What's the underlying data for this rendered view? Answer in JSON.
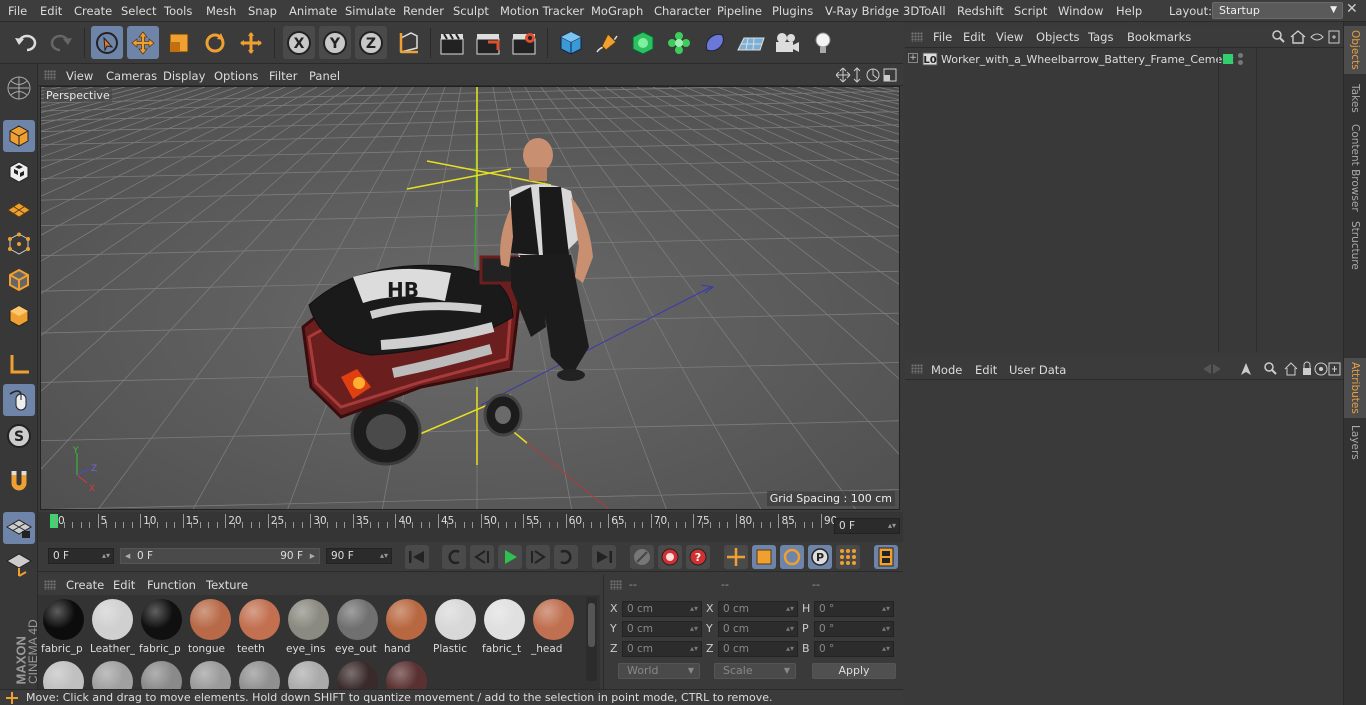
{
  "menu": [
    "File",
    "Edit",
    "Create",
    "Select",
    "Tools",
    "Mesh",
    "Snap",
    "Animate",
    "Simulate",
    "Render",
    "Sculpt",
    "Motion Tracker",
    "MoGraph",
    "Character",
    "Pipeline",
    "Plugins",
    "V-Ray Bridge",
    "3DToAll",
    "Redshift",
    "Script",
    "Window",
    "Help"
  ],
  "layout": {
    "label": "Layout:",
    "value": "Startup"
  },
  "viewport": {
    "menu": [
      "View",
      "Cameras",
      "Display",
      "Options",
      "Filter",
      "Panel"
    ],
    "camera_label": "Perspective",
    "grid_spacing": "Grid Spacing : 100 cm"
  },
  "timeline": {
    "ticks": [
      "0",
      "5",
      "10",
      "15",
      "20",
      "25",
      "30",
      "35",
      "40",
      "45",
      "50",
      "55",
      "60",
      "65",
      "70",
      "75",
      "80",
      "85",
      "90"
    ],
    "current_frame": "0 F",
    "start_field": "0 F",
    "range_start": "0 F",
    "range_end": "90 F",
    "end_field": "90 F"
  },
  "materials": {
    "menu": [
      "Create",
      "Edit",
      "Function",
      "Texture"
    ],
    "items": [
      {
        "name": "fabric_p",
        "color": "#0c0c0c"
      },
      {
        "name": "Leather_",
        "color": "#d0d0d0"
      },
      {
        "name": "fabric_p",
        "color": "#101010"
      },
      {
        "name": "tongue",
        "color": "#b86a48"
      },
      {
        "name": "teeth",
        "color": "#c27050"
      },
      {
        "name": "eye_ins",
        "color": "#8a8a80"
      },
      {
        "name": "eye_out",
        "color": "#707070"
      },
      {
        "name": "hand",
        "color": "#b86840"
      },
      {
        "name": "Plastic",
        "color": "#d8d8d8"
      },
      {
        "name": "fabric_t",
        "color": "#e0e0e0"
      },
      {
        "name": "_head",
        "color": "#c07050"
      }
    ]
  },
  "coords": {
    "headers": [
      "--",
      "--",
      "--"
    ],
    "rows": [
      {
        "l1": "X",
        "v1": "0 cm",
        "l2": "X",
        "v2": "0 cm",
        "l3": "H",
        "v3": "0 °"
      },
      {
        "l1": "Y",
        "v1": "0 cm",
        "l2": "Y",
        "v2": "0 cm",
        "l3": "P",
        "v3": "0 °"
      },
      {
        "l1": "Z",
        "v1": "0 cm",
        "l2": "Z",
        "v2": "0 cm",
        "l3": "B",
        "v3": "0 °"
      }
    ],
    "mode": "World",
    "scale": "Scale",
    "apply": "Apply"
  },
  "objects": {
    "menu": [
      "File",
      "Edit",
      "View",
      "Objects",
      "Tags",
      "Bookmarks"
    ],
    "item": "Worker_with_a_Wheelbarrow_Battery_Frame_Cement"
  },
  "attributes": {
    "menu": [
      "Mode",
      "Edit",
      "User Data"
    ]
  },
  "right_tabs": [
    "Objects",
    "Takes",
    "Content Browser",
    "Structure",
    "Attributes",
    "Layers"
  ],
  "brand": {
    "line1": "MAXON",
    "line2": "CINEMA 4D"
  },
  "status": "Move: Click and drag to move elements. Hold down SHIFT to quantize movement / add to the selection in point mode, CTRL to remove."
}
